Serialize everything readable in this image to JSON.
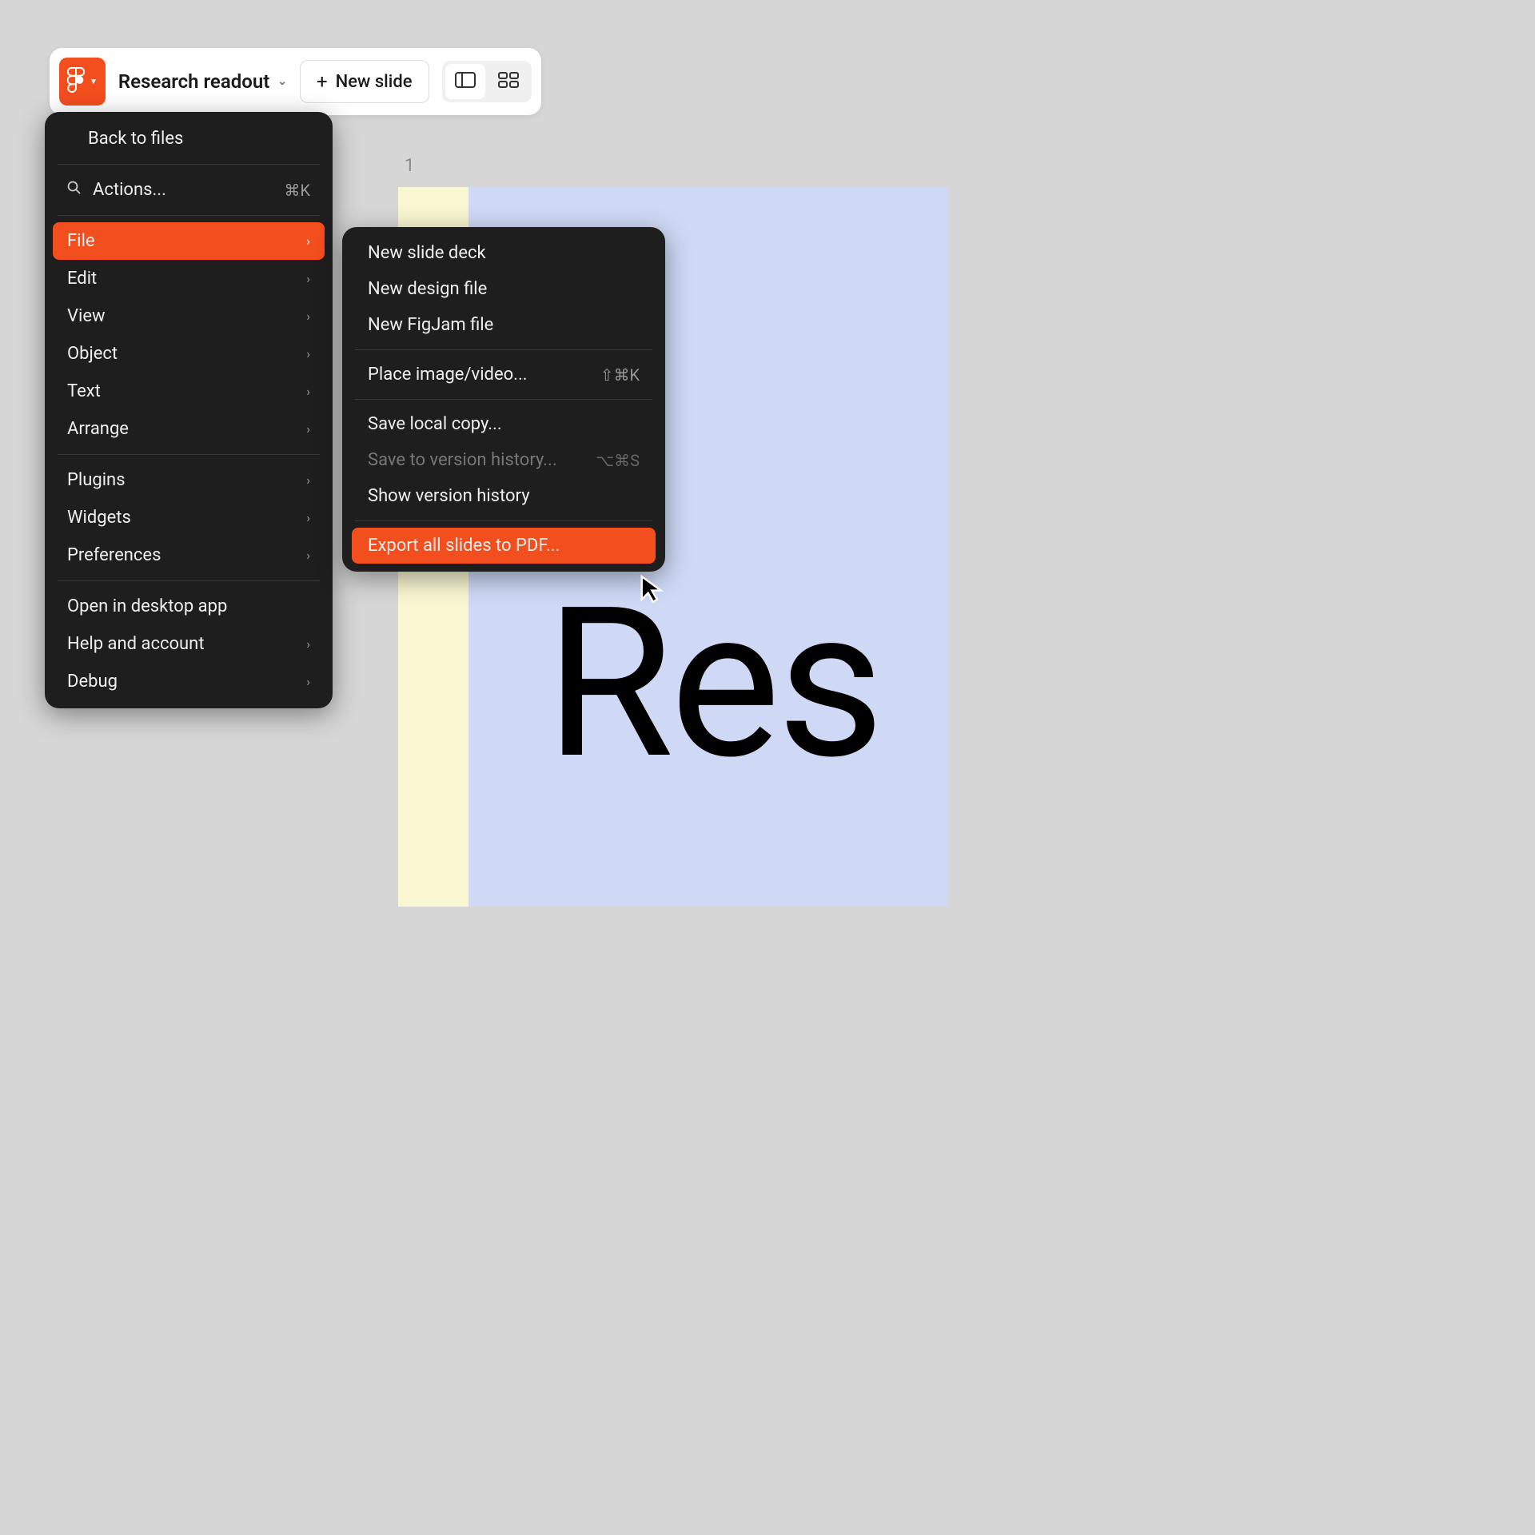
{
  "toolbar": {
    "file_name": "Research readout",
    "new_slide_label": "New slide"
  },
  "canvas": {
    "slide_number": "1",
    "slide_text_fragment": "Res"
  },
  "main_menu": {
    "back_to_files": "Back to files",
    "actions": "Actions...",
    "actions_shortcut": "⌘K",
    "file": "File",
    "edit": "Edit",
    "view": "View",
    "object": "Object",
    "text": "Text",
    "arrange": "Arrange",
    "plugins": "Plugins",
    "widgets": "Widgets",
    "preferences": "Preferences",
    "open_desktop": "Open in desktop app",
    "help_account": "Help and account",
    "debug": "Debug"
  },
  "sub_menu": {
    "new_slide_deck": "New slide deck",
    "new_design_file": "New design file",
    "new_figjam": "New FigJam file",
    "place_image": "Place image/video...",
    "place_image_shortcut": "⇧⌘K",
    "save_local": "Save local copy...",
    "save_version": "Save to version history...",
    "save_version_shortcut": "⌥⌘S",
    "show_version": "Show version history",
    "export_pdf": "Export all slides to PDF..."
  },
  "colors": {
    "accent": "#f24e1e",
    "menu_bg": "#1e1e1e",
    "slide_back": "#f9f7d1",
    "slide_front": "#cfd9f5"
  }
}
